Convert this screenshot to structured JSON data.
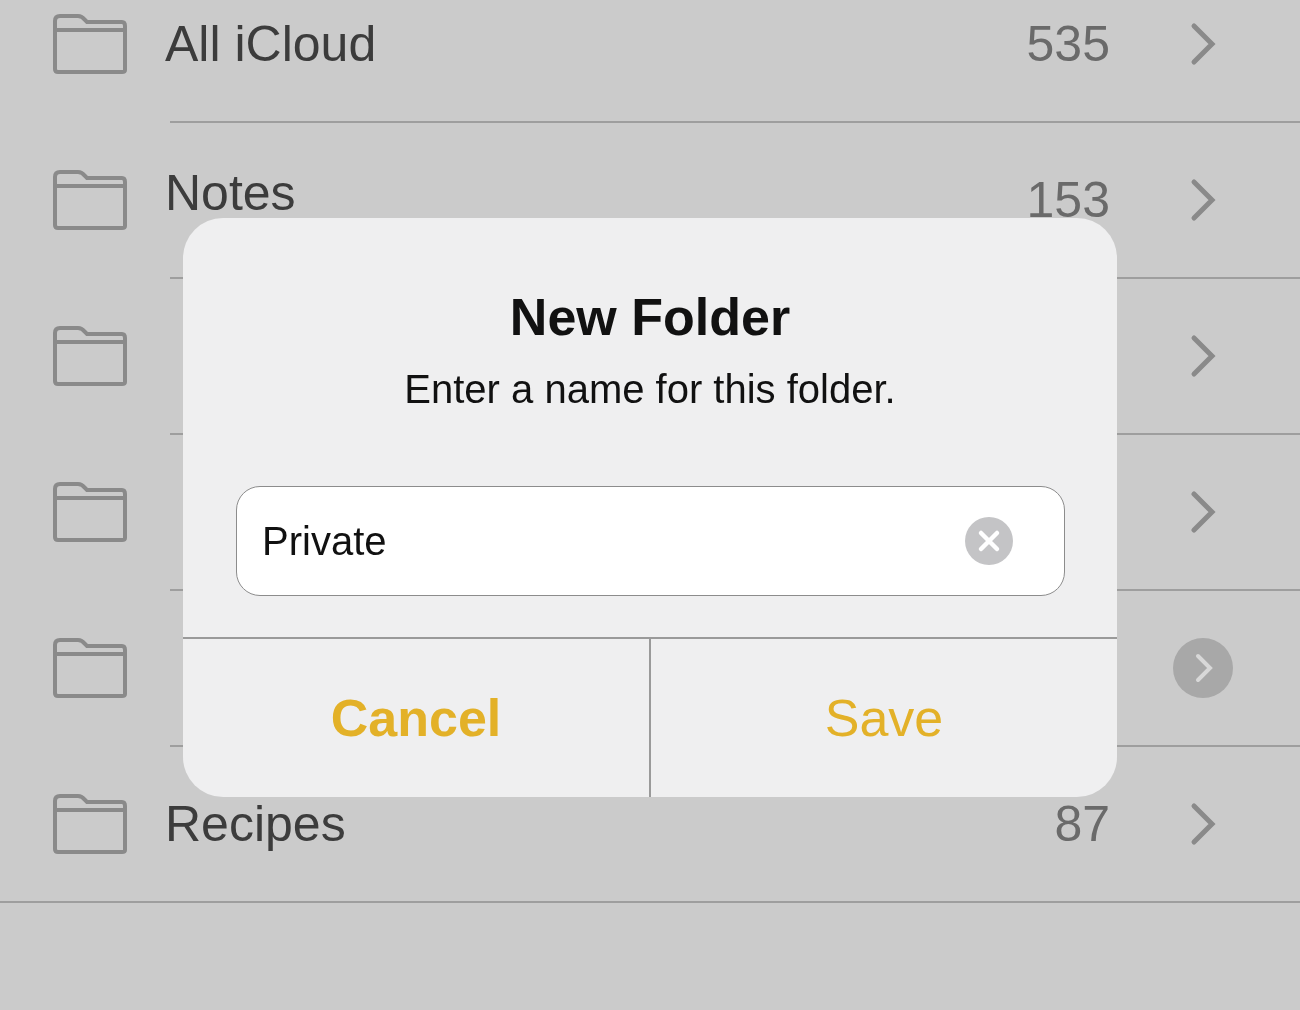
{
  "folders": [
    {
      "name": "All iCloud",
      "count": "535",
      "kind": "plain"
    },
    {
      "name": "Notes",
      "count": "153",
      "kind": "plain"
    },
    {
      "kind": "plain"
    },
    {
      "kind": "plain"
    },
    {
      "kind": "circled"
    },
    {
      "name": "Recipes",
      "count": "87",
      "kind": "plain"
    }
  ],
  "dialog": {
    "title": "New Folder",
    "message": "Enter a name for this folder.",
    "field": {
      "value": "Private"
    },
    "buttons": [
      {
        "label": "Cancel",
        "kind": "cancel"
      },
      {
        "label": "Save",
        "kind": "default"
      }
    ]
  }
}
